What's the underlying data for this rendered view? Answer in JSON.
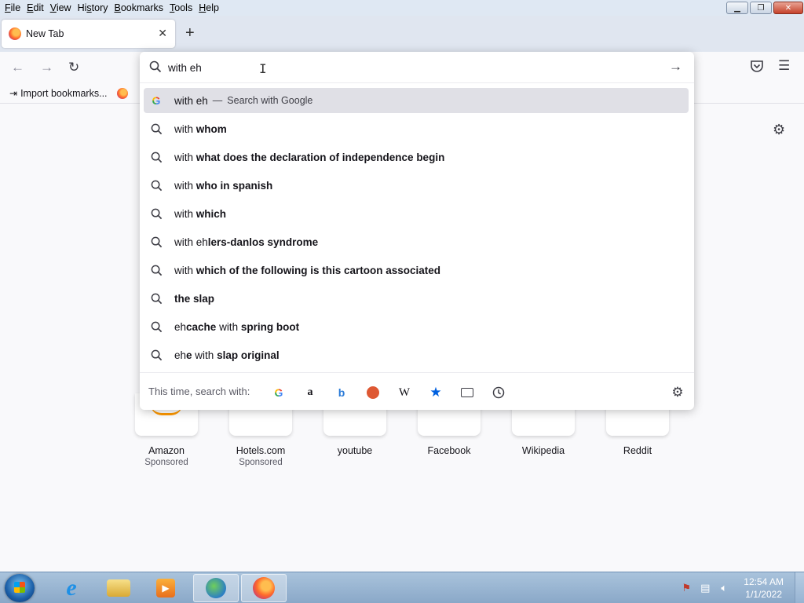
{
  "menubar": {
    "items": [
      {
        "label": "File",
        "ul": "F",
        "rest": "ile"
      },
      {
        "label": "Edit",
        "ul": "E",
        "rest": "dit"
      },
      {
        "label": "View",
        "ul": "V",
        "rest": "iew"
      },
      {
        "label": "History",
        "pre": "Hi",
        "ul": "s",
        "rest": "tory"
      },
      {
        "label": "Bookmarks",
        "ul": "B",
        "rest": "ookmarks"
      },
      {
        "label": "Tools",
        "ul": "T",
        "rest": "ools"
      },
      {
        "label": "Help",
        "ul": "H",
        "rest": "elp"
      }
    ]
  },
  "tabs": {
    "active": {
      "title": "New Tab"
    }
  },
  "bookmarks": {
    "import_label": "Import bookmarks..."
  },
  "urlbar": {
    "value": "with eh",
    "first_suggestion": {
      "query": "with eh",
      "separator": "—",
      "engine_label": "Search with Google"
    },
    "suggestions": [
      {
        "plain": "with ",
        "bold": "whom"
      },
      {
        "plain": "with ",
        "bold": "what does the declaration of independence begin"
      },
      {
        "plain": "with ",
        "bold": "who in spanish"
      },
      {
        "plain": "with ",
        "bold": "which"
      },
      {
        "plain": "with eh",
        "bold": "lers-danlos syndrome"
      },
      {
        "plain": "with ",
        "bold": "which of the following is this cartoon associated"
      },
      {
        "plain": "",
        "bold": "the slap"
      },
      {
        "plain": "eh",
        "bold": "cache",
        "plain2": " with ",
        "bold2": "spring boot"
      },
      {
        "plain": "eh",
        "bold": "e",
        "plain2": " with ",
        "bold2": "slap original"
      }
    ],
    "oneoff_label": "This time, search with:",
    "oneoff_engines": [
      "google-icon",
      "amazon-icon",
      "bing-icon",
      "duckduckgo-icon",
      "wikipedia-icon",
      "bookmarks-star-icon",
      "tabs-icon",
      "history-icon"
    ]
  },
  "top_sites": [
    {
      "name": "Amazon",
      "sponsored": "Sponsored"
    },
    {
      "name": "Hotels.com",
      "sponsored": "Sponsored"
    },
    {
      "name": "youtube",
      "sponsored": ""
    },
    {
      "name": "Facebook",
      "sponsored": ""
    },
    {
      "name": "Wikipedia",
      "sponsored": ""
    },
    {
      "name": "Reddit",
      "sponsored": ""
    }
  ],
  "taskbar": {
    "clock_time": "12:54 AM",
    "clock_date": "1/1/2022"
  },
  "colors": {
    "accent": "#0060df",
    "selected_row": "#e0e0e6",
    "taskbar": "#8aa8c8"
  }
}
